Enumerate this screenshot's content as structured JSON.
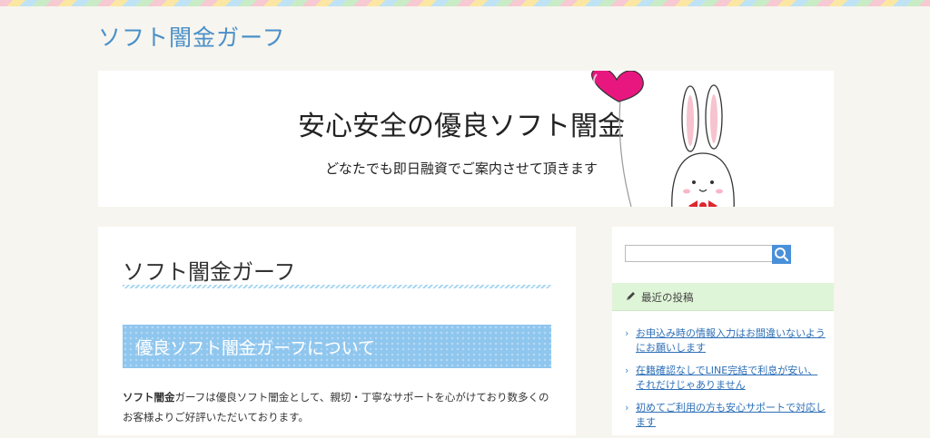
{
  "site": {
    "title": "ソフト闇金ガーフ"
  },
  "header": {
    "title": "安心安全の優良ソフト闇金",
    "subtitle": "どなたでも即日融資でご案内させて頂きます"
  },
  "main": {
    "title": "ソフト闇金ガーフ",
    "section_heading": "優良ソフト闇金ガーフについて",
    "body_bold": "ソフト闇金",
    "body_text": "ガーフは優良ソフト闇金として、親切・丁寧なサポートを心がけており数多くのお客様よりご好評いただいております。"
  },
  "sidebar": {
    "search": {
      "value": ""
    },
    "recent_title": "最近の投稿",
    "posts": [
      {
        "label": "お申込み時の情報入力はお間違いないようにお願いします"
      },
      {
        "label": "在籍確認なしでLINE完結で利息が安い、それだけじゃありません"
      },
      {
        "label": "初めてご利用の方も安心サポートで対応します"
      }
    ]
  },
  "icons": {
    "search": "search-icon",
    "pencil": "pencil-icon",
    "chevron": "chevron-right-icon",
    "heart": "heart-balloon-icon",
    "bunny": "bunny-illustration"
  },
  "colors": {
    "link": "#2d6fb6",
    "title_blue": "#4a90c9",
    "section_bar": "#8fc6ee",
    "widget_head": "#dff5d8",
    "heart": "#e8177f"
  }
}
